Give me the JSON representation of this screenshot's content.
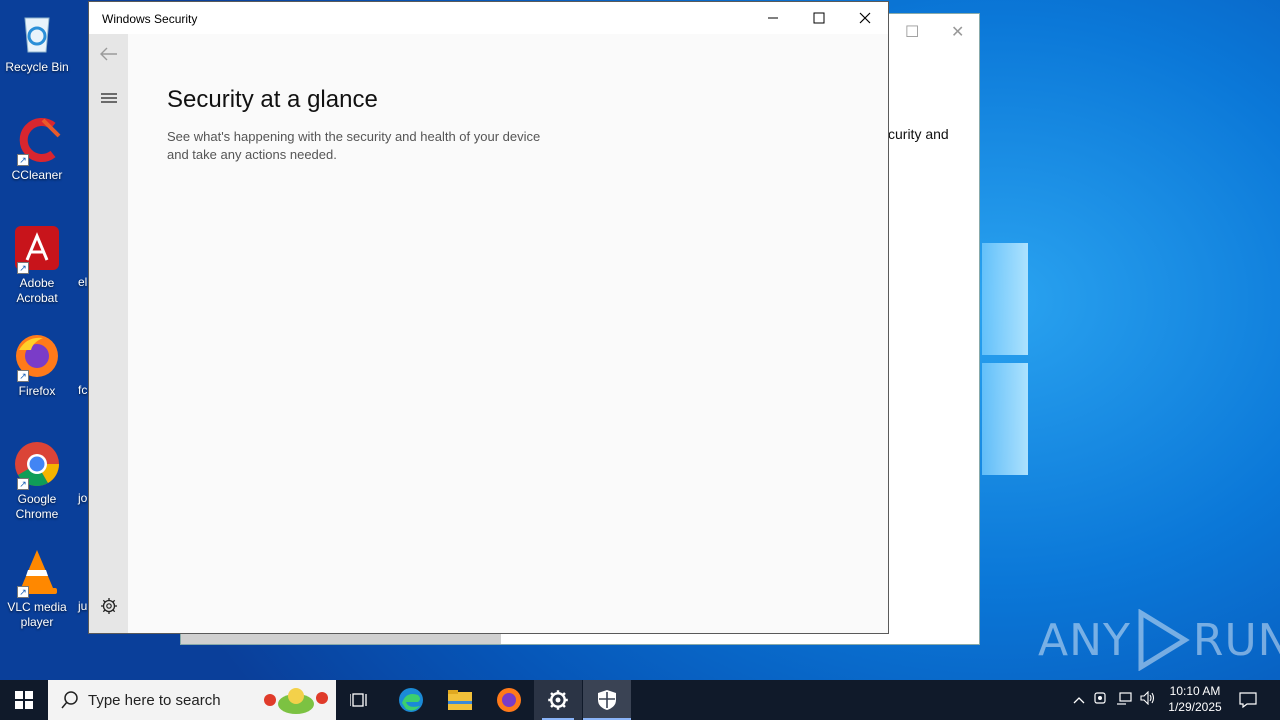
{
  "desktop": {
    "icons": [
      {
        "label": "Recycle Bin"
      },
      {
        "label": "CCleaner"
      },
      {
        "label": "Adobe Acrobat"
      },
      {
        "label": "Firefox"
      },
      {
        "label": "Google Chrome"
      },
      {
        "label": "VLC media player"
      }
    ],
    "peeks": [
      "el",
      "fc",
      "jo",
      "ju"
    ]
  },
  "background_window": {
    "visible_text": "curity and"
  },
  "window": {
    "title": "Windows Security",
    "heading": "Security at a glance",
    "description": "See what's happening with the security and health of your device and take any actions needed."
  },
  "watermark": {
    "text_left": "ANY",
    "text_right": "RUN"
  },
  "taskbar": {
    "search_placeholder": "Type here to search",
    "apps": [
      "task-view",
      "edge",
      "file-explorer",
      "firefox",
      "settings",
      "windows-security"
    ],
    "clock_time": "10:10 AM",
    "clock_date": "1/29/2025"
  },
  "colors": {
    "taskbar_bg": "#101a2a",
    "accent": "#0078d7",
    "sidebar_bg": "#e6e6e6"
  }
}
